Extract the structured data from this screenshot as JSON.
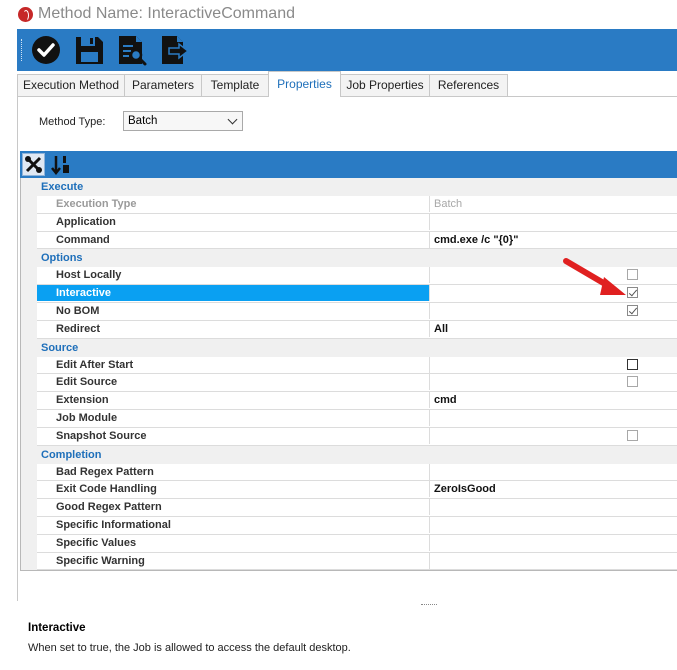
{
  "window": {
    "title": "Method Name: InteractiveCommand"
  },
  "toolbar": {
    "buttons": [
      {
        "icon": "check-circle-icon",
        "label": ""
      },
      {
        "icon": "save-icon",
        "label": ""
      },
      {
        "icon": "search-document-icon",
        "label": ""
      },
      {
        "icon": "export-document-icon",
        "label": ""
      }
    ]
  },
  "tabs": [
    {
      "label": "Execution Method",
      "active": false
    },
    {
      "label": "Parameters",
      "active": false
    },
    {
      "label": "Template",
      "active": false
    },
    {
      "label": "Properties",
      "active": true
    },
    {
      "label": "Job Properties",
      "active": false
    },
    {
      "label": "References",
      "active": false
    }
  ],
  "method_type": {
    "label": "Method Type:",
    "value": "Batch"
  },
  "grid_toolbar": {
    "buttons": [
      "wrench-icon",
      "sort-az-icon"
    ]
  },
  "categories": [
    {
      "name": "Execute",
      "rows": [
        {
          "name": "Execution Type",
          "value": "Batch",
          "disabled": true
        },
        {
          "name": "Application",
          "value": ""
        },
        {
          "name": "Command",
          "value": "cmd.exe /c \"{0}\""
        }
      ]
    },
    {
      "name": "Options",
      "rows": [
        {
          "name": "Host Locally",
          "checkbox": false
        },
        {
          "name": "Interactive",
          "checkbox": true,
          "selected": true
        },
        {
          "name": "No BOM",
          "checkbox": true
        },
        {
          "name": "Redirect",
          "value": "All"
        }
      ]
    },
    {
      "name": "Source",
      "rows": [
        {
          "name": "Edit After Start",
          "checkbox": false
        },
        {
          "name": "Edit Source",
          "checkbox": false
        },
        {
          "name": "Extension",
          "value": "cmd"
        },
        {
          "name": "Job Module",
          "value": ""
        },
        {
          "name": "Snapshot Source",
          "checkbox": false
        }
      ]
    },
    {
      "name": "Completion",
      "rows": [
        {
          "name": "Bad Regex Pattern",
          "value": ""
        },
        {
          "name": "Exit Code Handling",
          "value": "ZeroIsGood"
        },
        {
          "name": "Good Regex Pattern",
          "value": ""
        },
        {
          "name": "Specific Informational",
          "value": ""
        },
        {
          "name": "Specific Values",
          "value": ""
        },
        {
          "name": "Specific Warning",
          "value": ""
        }
      ]
    }
  ],
  "description": {
    "title": "Interactive",
    "text": "When set to true, the Job is allowed to access the default desktop."
  },
  "colors": {
    "accent": "#2a7bc4",
    "selection": "#0aa0f2",
    "category_text": "#1e6fba",
    "arrow": "#e02020"
  }
}
